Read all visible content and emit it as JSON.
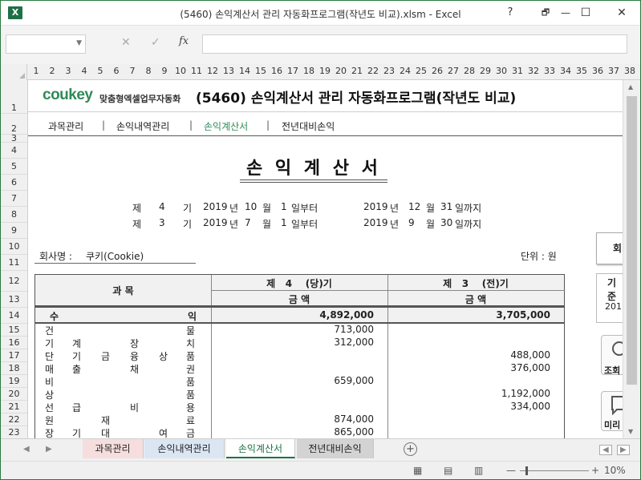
{
  "window": {
    "title": "(5460) 손익계산서 관리 자동화프로그램(작년도 비교).xlsm - Excel",
    "app_icon": "X",
    "controls": {
      "help": "?",
      "restore": "🗗",
      "minimize": "—",
      "maximize": "☐",
      "close": "✕"
    }
  },
  "formula_bar": {
    "name_box": "",
    "formula": "",
    "fx": "fx",
    "cancel": "✕",
    "enter": "✓"
  },
  "columns": [
    "1",
    "2",
    "3",
    "4",
    "5",
    "6",
    "7",
    "8",
    "9",
    "10",
    "11",
    "12",
    "13",
    "14",
    "15",
    "16",
    "17",
    "18",
    "19",
    "20",
    "21",
    "22",
    "23",
    "24",
    "25",
    "26",
    "27",
    "28",
    "29",
    "30",
    "31",
    "32",
    "33",
    "34",
    "35",
    "36",
    "37",
    "38"
  ],
  "rows": [
    "1",
    "2",
    "3",
    "4",
    "5",
    "6",
    "7",
    "8",
    "9",
    "10",
    "11",
    "12",
    "13",
    "14",
    "15",
    "16",
    "17",
    "18",
    "19",
    "20",
    "21",
    "22",
    "23"
  ],
  "header": {
    "logo": "coukey",
    "logo_sub": "맞춤형엑셀업무자동화",
    "program_title": "(5460) 손익계산서 관리 자동화프로그램(작년도 비교)"
  },
  "nav": [
    "과목관리",
    "손익내역관리",
    "손익계산서",
    "전년대비손익"
  ],
  "nav_active_color": "#2e8b57",
  "statement": {
    "title": "손 익 계 산 서",
    "periods": [
      {
        "je": "제",
        "num": "4",
        "gi": "기",
        "y1": "2019",
        "nyeon1": "년",
        "m1": "10",
        "wol1": "월",
        "d1": "1",
        "from": "일부터",
        "y2": "2019",
        "nyeon2": "년",
        "m2": "12",
        "wol2": "월",
        "d2": "31",
        "to": "일까지"
      },
      {
        "je": "제",
        "num": "3",
        "gi": "기",
        "y1": "2019",
        "nyeon1": "년",
        "m1": "7",
        "wol1": "월",
        "d1": "1",
        "from": "일부터",
        "y2": "2019",
        "nyeon2": "년",
        "m2": "9",
        "wol2": "월",
        "d2": "30",
        "to": "일까지"
      }
    ],
    "company_label": "회사명 :",
    "company_name": "쿠키(Cookie)",
    "unit": "단위 : 원"
  },
  "table": {
    "subject_header": "과 목",
    "col1_header": "제   4    (당)기",
    "col2_header": "제   3    (전)기",
    "amount_header": "금 액",
    "total": {
      "label_left": "수",
      "label_right": "익",
      "cur": "4,892,000",
      "prev": "3,705,000"
    },
    "rows": [
      {
        "chars": [
          "건",
          "",
          "",
          "",
          "",
          "물"
        ],
        "cur": "713,000",
        "prev": ""
      },
      {
        "chars": [
          "기",
          "계",
          "",
          "장",
          "",
          "치"
        ],
        "cur": "312,000",
        "prev": ""
      },
      {
        "chars": [
          "단",
          "기",
          "금",
          "융",
          "상",
          "품"
        ],
        "cur": "",
        "prev": "488,000"
      },
      {
        "chars": [
          "매",
          "출",
          "",
          "채",
          "",
          "권"
        ],
        "cur": "",
        "prev": "376,000"
      },
      {
        "chars": [
          "비",
          "",
          "",
          "",
          "",
          "품"
        ],
        "cur": "659,000",
        "prev": ""
      },
      {
        "chars": [
          "상",
          "",
          "",
          "",
          "",
          "품"
        ],
        "cur": "",
        "prev": "1,192,000"
      },
      {
        "chars": [
          "선",
          "급",
          "",
          "비",
          "",
          "용"
        ],
        "cur": "",
        "prev": "334,000"
      },
      {
        "chars": [
          "원",
          "",
          "재",
          "",
          "",
          "료"
        ],
        "cur": "874,000",
        "prev": ""
      },
      {
        "chars": [
          "장",
          "기",
          "대",
          "",
          "여",
          "금"
        ],
        "cur": "865,000",
        "prev": ""
      }
    ]
  },
  "side_panel": {
    "button": "회",
    "period_label": "기준",
    "period_value": "201",
    "query_label": "조회",
    "preview_label": "미리"
  },
  "sheet_tabs": [
    {
      "label": "과목관리",
      "color": "#f6dede",
      "active": false
    },
    {
      "label": "손익내역관리",
      "color": "#dbe6f4",
      "active": false
    },
    {
      "label": "손익계산서",
      "color": "#ffffff",
      "active": true
    },
    {
      "label": "전년대비손익",
      "color": "#d3d3d3",
      "active": false
    }
  ],
  "status": {
    "zoom": "10%",
    "minus": "—",
    "plus": "+"
  }
}
